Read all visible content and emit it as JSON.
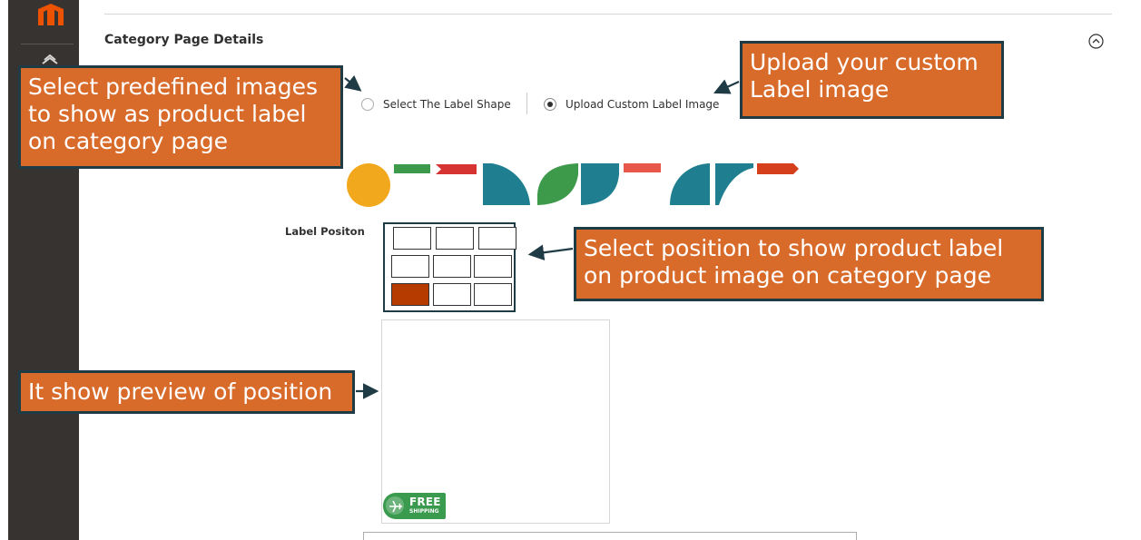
{
  "sidebar": {
    "logo_icon": "magento-logo-icon",
    "items": [
      {
        "icon": "dashboard-icon"
      }
    ]
  },
  "section": {
    "title": "Category Page Details",
    "collapse_icon": "collapse-up-icon"
  },
  "label_source": {
    "options": [
      {
        "label": "Select The Label Shape",
        "selected": false
      },
      {
        "label": "Upload Custom Label Image",
        "selected": true
      }
    ]
  },
  "shapes": {
    "colors": [
      "#f2a81d",
      "#3d9a4b",
      "#d63333",
      "#1f7f90",
      "#3d9a4b",
      "#1f7f90",
      "#e8584a",
      "#1f7f90",
      "#1f7f90",
      "#d63f1c"
    ]
  },
  "label_position": {
    "label": "Label Positon",
    "selected": "bottom-left",
    "grid_size": "3x3"
  },
  "preview": {
    "badge_free": "FREE",
    "badge_shipping": "SHIPPING",
    "badge_icon": "airplane-icon",
    "badge_color": "#3a9a4e"
  },
  "annotations": {
    "predefined": "Select predefined images\nto show as product label\non category page",
    "custom": "Upload your custom\nLabel image",
    "position": "Select position to show product label\non product image on category page",
    "preview": "It show preview of position"
  },
  "colors": {
    "sidebar_bg": "#373330",
    "callout_bg": "#d86a2a",
    "callout_border": "#1f3b45",
    "selected_cell": "#b53b00"
  }
}
